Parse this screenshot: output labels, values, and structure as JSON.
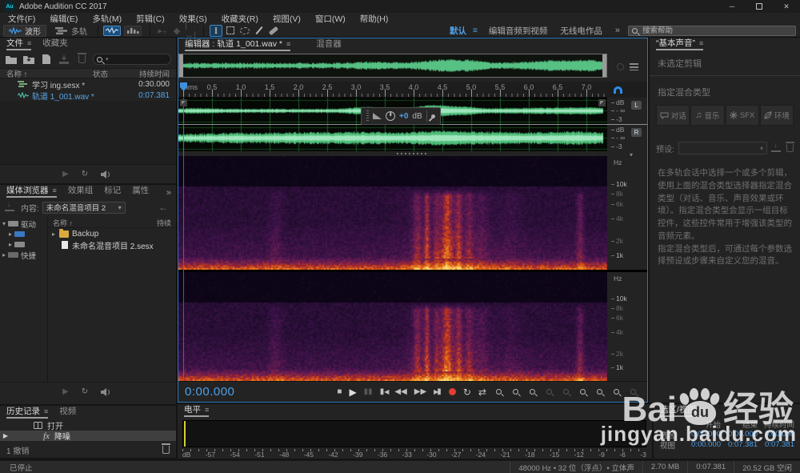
{
  "window": {
    "app_icon": "Au",
    "title": "Adobe Audition CC 2017",
    "minimize": "─",
    "close": "✕"
  },
  "menu_bar": {
    "items": [
      "文件(F)",
      "编辑(E)",
      "多轨(M)",
      "剪辑(C)",
      "效果(S)",
      "收藏夹(R)",
      "视图(V)",
      "窗口(W)",
      "帮助(H)"
    ]
  },
  "toolbar": {
    "waveform": "波形",
    "multitrack": "多轨",
    "workspace_default": "默认",
    "workspace_edit_av": "编辑音频到视频",
    "workspace_radio": "无线电作品",
    "workspace_overflow": "»",
    "search_placeholder": "搜索帮助"
  },
  "files_panel": {
    "tab_files": "文件",
    "tab_favorites": "收藏夹",
    "col_name": "名称",
    "col_status": "状态",
    "col_duration": "持续时间",
    "rows": [
      {
        "name": "学习 ing.sesx *",
        "duration": "0:30.000"
      },
      {
        "name": "轨道 1_001.wav *",
        "duration": "0:07.381"
      }
    ]
  },
  "media_browser": {
    "tab_media": "媒体浏览器",
    "tab_effects": "效果组",
    "tab_markers": "标记",
    "tab_properties": "属性",
    "overflow": "»",
    "content_label": "内容:",
    "content_value": "未命名混音项目 2",
    "tree_drives": "驱动",
    "tree_shortcuts": "快捷",
    "col_name": "名称",
    "col_duration": "持续",
    "rows": [
      {
        "name": "Backup"
      },
      {
        "name": "未命名混音项目 2.sesx"
      }
    ]
  },
  "history_panel": {
    "tab_history": "历史记录",
    "tab_video": "视频",
    "item_open": "打开",
    "item_fx_prefix": "fx",
    "item_noise_reduction": "降噪",
    "undo_info": "1 撤销"
  },
  "editor": {
    "tab_editor": "编辑器 : 轨道 1_001.wav *",
    "tab_mixer": "混音器",
    "ruler_unit": "hms",
    "ruler_ticks": [
      "0.5",
      "1.0",
      "1.5",
      "2.0",
      "2.5",
      "3.0",
      "3.5",
      "4.0",
      "4.5",
      "5.0",
      "5.5",
      "6.0",
      "6.5",
      "7.0"
    ],
    "hud_gain": "+0",
    "hud_unit": "dB",
    "db_label": "dB",
    "db_inf": "- ∞",
    "db_m3": "-3",
    "badge_left": "L",
    "badge_right": "R",
    "hz_label": "Hz",
    "freq_ticks": [
      "10k",
      "8k",
      "6k",
      "4k",
      "2k",
      "1k"
    ],
    "time_display": "0:00.000"
  },
  "essential_sound": {
    "tab": "“基本声音”",
    "no_clip": "未选定剪辑",
    "assign_label": "指定混合类型",
    "type_dialogue": "对话",
    "type_music": "音乐",
    "type_sfx": "SFX",
    "type_ambience": "环境",
    "preset_label": "预设:",
    "desc1": "在多轨会话中选择一个或多个剪辑，使用上面的混合类型选择器指定混合类型（对话、音乐、声音效果或环境）。指定混合类型会显示一组目标控件，这些控件常用于增强该类型的音频元素。",
    "desc2": "指定混合类型后，可通过每个参数选择预设或步骤来自定义您的混音。"
  },
  "levels_panel": {
    "tab": "电平",
    "scale": [
      "dB",
      "-57",
      "-54",
      "-51",
      "-48",
      "-45",
      "-42",
      "-39",
      "-36",
      "-33",
      "-30",
      "-27",
      "-24",
      "-21",
      "-18",
      "-15",
      "-12",
      "-9",
      "-6",
      "-3"
    ]
  },
  "selection_view_panel": {
    "tab": "选区/视图",
    "col_start": "开始",
    "col_end": "结束",
    "col_duration": "持续时间",
    "row_selection_label": "选区",
    "row_view_label": "视图",
    "selection": {
      "start": "0:00.000",
      "end": "0:00.000",
      "duration": "0:00.000"
    },
    "view": {
      "start": "0:00.000",
      "end": "0:07.381",
      "duration": "0:07.381"
    }
  },
  "status_bar": {
    "playback": "已停止",
    "format": "48000 Hz • 32 位（浮点）• 立体声",
    "file_size": "2.70 MB",
    "duration": "0:07.381",
    "free_space": "20.52 GB 空闲"
  },
  "watermark": {
    "text_latin": "Bai",
    "paw_text": "du",
    "text_cn": "经验",
    "url": "jingyan.baidu.com"
  },
  "glyphs": {
    "menu": "≡",
    "sort_up": "↑",
    "chevron": "▾",
    "expand": "▸",
    "back": "←",
    "play": "▶",
    "stop": "■",
    "record": "",
    "loop": "↻",
    "swap": "⇄"
  }
}
